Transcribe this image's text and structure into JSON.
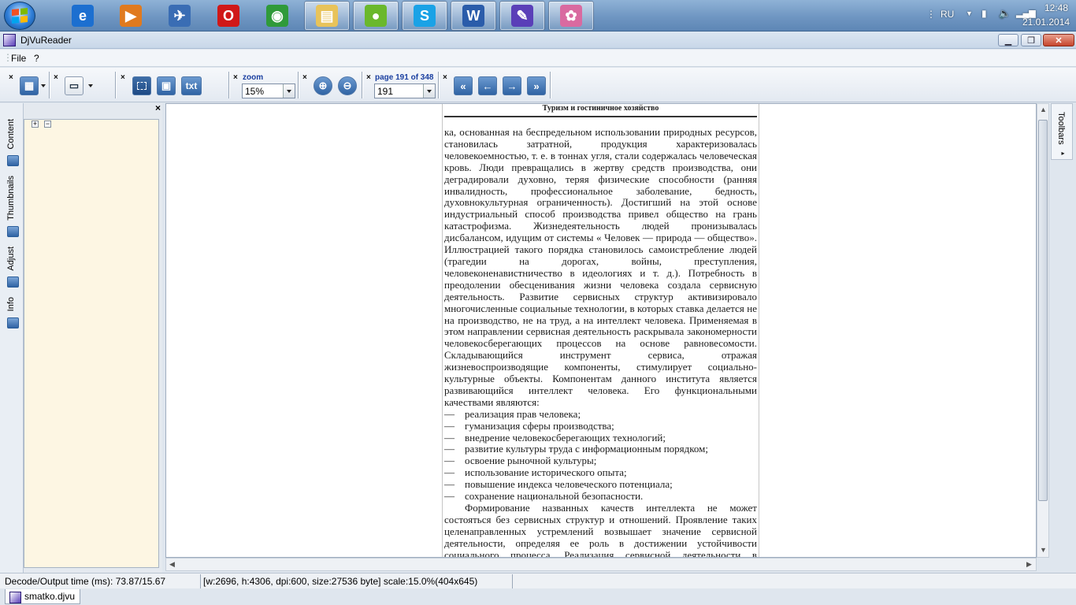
{
  "taskbar": {
    "apps": [
      {
        "name": "internet-explorer-icon",
        "glyph": "e",
        "color": "#1c6fd0"
      },
      {
        "name": "media-player-icon",
        "glyph": "▶",
        "color": "#e07a1f"
      },
      {
        "name": "satellite-icon",
        "glyph": "✈",
        "color": "#3a6db4"
      },
      {
        "name": "opera-icon",
        "glyph": "O",
        "color": "#d01818"
      },
      {
        "name": "chrome-icon",
        "glyph": "◉",
        "color": "#2f9a3a"
      },
      {
        "name": "file-explorer-icon",
        "glyph": "▤",
        "color": "#e8c35a"
      },
      {
        "name": "green-ball-icon",
        "glyph": "●",
        "color": "#6ab82c"
      },
      {
        "name": "skype-icon",
        "glyph": "S",
        "color": "#1aa2e6"
      },
      {
        "name": "word-icon",
        "glyph": "W",
        "color": "#2a5caa"
      },
      {
        "name": "djvureader-icon",
        "glyph": "✎",
        "color": "#5a3fb8"
      },
      {
        "name": "paint-icon",
        "glyph": "✿",
        "color": "#d96aa0"
      }
    ],
    "tray": {
      "lang": "RU",
      "time": "12:48",
      "date": "21.01.2014"
    }
  },
  "window": {
    "title": "DjVuReader"
  },
  "menu": {
    "file": "File",
    "help": "?"
  },
  "toolbar": {
    "zoom_label": "zoom",
    "zoom_value": "15%",
    "page_label": "page 191 of 348",
    "page_value": "191",
    "txt_label": "txt",
    "group_close": "×"
  },
  "sidebar": {
    "tabs": [
      "Content",
      "Thumbnails",
      "Adjust",
      "Info"
    ],
    "close": "×",
    "expand": "+",
    "collapse": "−"
  },
  "right_tab": {
    "label": "Toolbars"
  },
  "document": {
    "header": "Туризм и гостиничное хозяйство",
    "paragraph1": "ка, основанная на беспредельном использовании природных ресурсов, становилась затратной, продукция характеризовалась человекоемностью, т. е. в тоннах угля, стали содержалась человеческая кровь. Люди превращались в жертву средств производства, они деградировали духовно, теряя физические способности (ранняя инвалидность, профессиональное заболевание, бедность, духовнокультурная ограниченность). Достигший на этой основе индустриальный способ производства привел общество на грань катастрофизма. Жизнедеятельность людей пронизывалась дисбалансом, идущим от системы « Человек — природа — общество». Иллюстрацией такого порядка становилось самоистребление людей (трагедии на дорогах, войны, преступления, человеконенавистничество в идеологиях и т. д.). Потребность в преодолении обесценивания жизни человека создала сервисную деятельность. Развитие сервисных структур активизировало многочисленные социальные технологии, в которых ставка делается не на производство, не на труд, а на интеллект человека. Применяемая в этом направлении сервисная деятельность раскрывала закономерности человекосберегающих процессов на основе равновесомости. Складывающийся инструмент сервиса, отражая жизневоспроизводящие компоненты, стимулирует социально-культурные объекты. Компонентам данного института является развивающийся интеллект человека. Его функциональными качествами являются:",
    "list": [
      "реализация прав человека;",
      "гуманизация сферы производства;",
      "внедрение человекосберегающих технологий;",
      "развитие культуры труда с информационным порядком;",
      "освоение рыночной культуры;",
      "использование исторического опыта;",
      "повышение индекса человеческого потенциала;",
      "сохранение национальной безопасности."
    ],
    "paragraph2": "Формирование названных качеств интеллекта не может состояться без сервисных структур и отношений. Проявление таких целенаправленных устремлений возвышает значение сервисной деятельности, определяя ее роль в достижении устойчивости социального процесса. Реализация сервисной деятельности в практическом аспекте придает ей реабилитационную направленность жизнедеятельности"
  },
  "status": {
    "decode": "Decode/Output time (ms): 73.87/15.67",
    "info": "[w:2696, h:4306, dpi:600, size:27536 byte] scale:15.0%(404x645)"
  },
  "file_tab": {
    "name": "smatko.djvu"
  }
}
